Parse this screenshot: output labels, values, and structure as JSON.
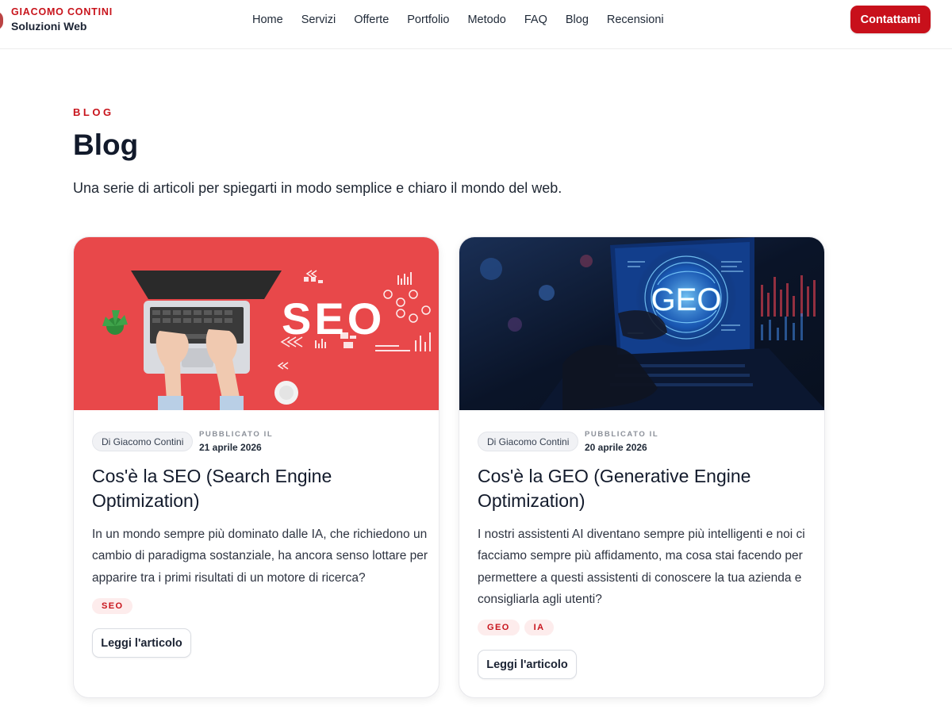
{
  "header": {
    "brand_name": "GIACOMO CONTINI",
    "brand_sub": "Soluzioni Web",
    "nav": [
      "Home",
      "Servizi",
      "Offerte",
      "Portfolio",
      "Metodo",
      "FAQ",
      "Blog",
      "Recensioni"
    ],
    "cta_label": "Contattami"
  },
  "hero": {
    "eyebrow": "BLOG",
    "title": "Blog",
    "intro": "Una serie di articoli per spiegarti in modo semplice e chiaro il mondo del web."
  },
  "posts": [
    {
      "cover_text": "SEO",
      "author": "Di Giacomo Contini",
      "published_label": "PUBBLICATO IL",
      "date": "21 aprile 2026",
      "title": "Cos'è la SEO (Search Engine Optimization)",
      "excerpt": "In un mondo sempre più dominato dalle IA, che richiedono un cambio di paradigma sostanziale, ha ancora senso lottare per apparire tra i primi risultati di un motore di ricerca?",
      "tags": [
        "SEO"
      ],
      "read_label": "Leggi l'articolo"
    },
    {
      "cover_text": "GEO",
      "author": "Di Giacomo Contini",
      "published_label": "PUBBLICATO IL",
      "date": "20 aprile 2026",
      "title": "Cos'è la GEO (Generative Engine Optimization)",
      "excerpt": "I nostri assistenti AI diventano sempre più intelligenti e noi ci facciamo sempre più affidamento, ma cosa stai facendo per permettere a questi assistenti di conoscere la tua azienda e consigliarla agli utenti?",
      "tags": [
        "GEO",
        "IA"
      ],
      "read_label": "Leggi l'articolo"
    }
  ],
  "colors": {
    "accent": "#c8141c",
    "seo_cover_bg": "#e8484a",
    "geo_cover_bg": "#0b1a33"
  }
}
